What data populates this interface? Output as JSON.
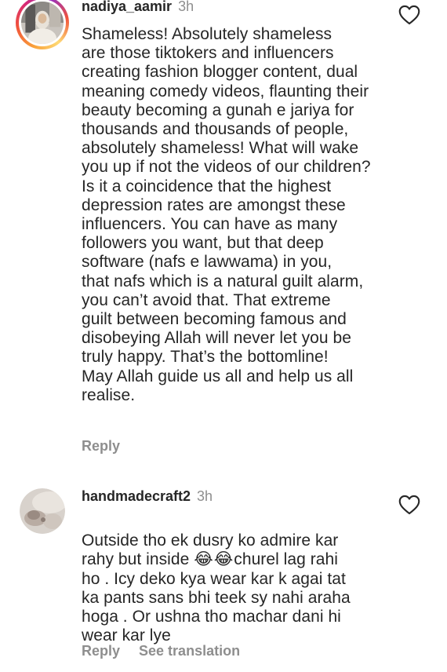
{
  "comments": [
    {
      "username": "nadiya_aamir",
      "time": "3h",
      "text": "Shameless! Absolutely shameless\nare those tiktokers and influencers\ncreating fashion blogger content, dual\nmeaning comedy videos, flaunting their\nbeauty becoming a gunah e jariya for\nthousands and thousands of people,\nabsolutely shameless! What will wake\nyou up if not the videos of our children?\nIs it a coincidence that the highest\ndepression rates are amongst these\ninfluencers. You can have as many\nfollowers you want, but that deep\nsoftware (nafs e lawwama) in you,\nthat nafs which is a natural guilt alarm,\nyou can’t avoid that. That extreme\nguilt between becoming famous and\ndisobeying Allah will never let you be\ntruly happy. That’s the bottomline!\nMay Allah guide us all and help us all\nrealise.",
      "reply_label": "Reply",
      "like_icon": "heart-outline-icon"
    },
    {
      "username": "handmadecraft2",
      "time": "3h",
      "text_before_emoji": "Outside tho ek dusry ko admire kar\nrahy but inside ",
      "emoji": "😂😂",
      "text_after_emoji": "churel lag rahi\nho . Icy deko kya wear kar k agai tat\nka pants sans bhi teek sy nahi araha\nhoga . Or ushna tho machar dani hi\nwear kar lye",
      "reply_label": "Reply",
      "translate_label": "See translation",
      "like_icon": "heart-outline-icon"
    }
  ],
  "colors": {
    "text": "#262626",
    "secondary": "#8e8e8e",
    "background": "#ffffff"
  }
}
